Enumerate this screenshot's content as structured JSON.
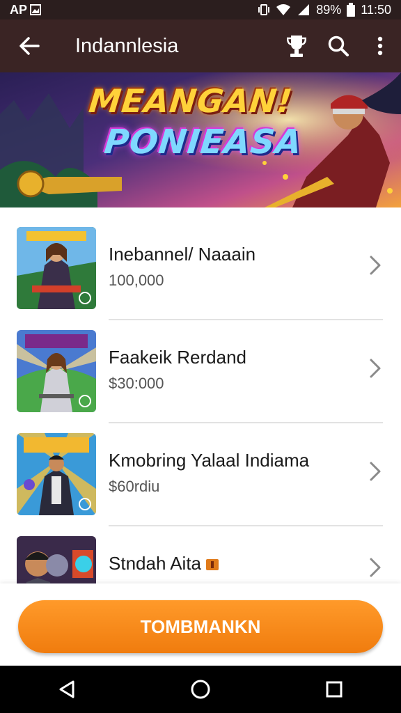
{
  "status_bar": {
    "carrier": "AP",
    "battery_percent": "89%",
    "time": "11:50"
  },
  "app_bar": {
    "title": "Indannlesia",
    "icons": [
      "back-arrow-icon",
      "trophy-icon",
      "search-icon",
      "more-vert-icon"
    ]
  },
  "banner": {
    "title_line1": "MEANGAN!",
    "title_line2": "PONIEASA"
  },
  "items": [
    {
      "name": "Inebannel/ Naaain",
      "price": "100,000",
      "icon": "chevron-right-icon"
    },
    {
      "name": "Faakeik Rerdand",
      "price": "$30:000",
      "icon": "chevron-right-icon"
    },
    {
      "name": "Kmobring Yalaal Indiama",
      "price": "$60rdiu",
      "icon": "chevron-right-icon"
    },
    {
      "name": "Stndah Aita",
      "price": "",
      "icon": "chevron-right-icon"
    }
  ],
  "cta_button": {
    "label": "TOMBMANKN"
  },
  "nav_bar": {
    "icons": [
      "back-triangle-icon",
      "home-circle-icon",
      "recents-square-icon"
    ]
  },
  "colors": {
    "app_bar": "#3a2424",
    "accent": "#f28a1c"
  }
}
